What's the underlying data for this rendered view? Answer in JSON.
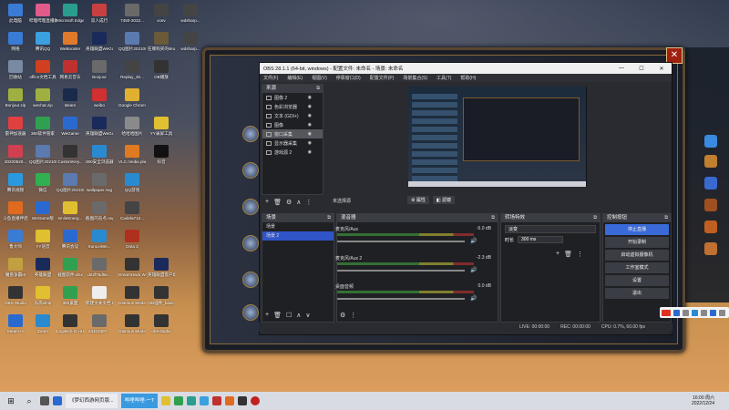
{
  "desktop": {
    "icons": [
      {
        "label": "此电脑",
        "color": "#3a7bd5"
      },
      {
        "label": "哔哩哔哩直播姬",
        "color": "#e05a8a"
      },
      {
        "label": "Microsoft Edge",
        "color": "#2a9d8f"
      },
      {
        "label": "双人成行",
        "color": "#c94040"
      },
      {
        "label": "7450-2022...",
        "color": "#6a6a6a"
      },
      {
        "label": "xcev",
        "color": "#444"
      },
      {
        "label": "wdsharp...",
        "color": "#444"
      },
      {
        "label": "网络",
        "color": "#3a7bd5"
      },
      {
        "label": "腾讯QQ",
        "color": "#3aa0e0"
      },
      {
        "label": "WeBooster",
        "color": "#e07a2a"
      },
      {
        "label": "英雄联盟WeGame版",
        "color": "#1a2a5a"
      },
      {
        "label": "QQ图片20210821...",
        "color": "#5a7ab0"
      },
      {
        "label": "在哪购买的sku...",
        "color": "#6a5a3a"
      },
      {
        "label": "wdsharp...",
        "color": "#444"
      },
      {
        "label": "回收站",
        "color": "#7a8aa0"
      },
      {
        "label": "office文档工具",
        "color": "#d04020"
      },
      {
        "label": "网易云音乐",
        "color": "#c03030"
      },
      {
        "label": "Bonjour",
        "color": "#6a6a6a"
      },
      {
        "label": "Replay_20...",
        "color": "#444"
      },
      {
        "label": "OB播放",
        "color": "#333"
      },
      {
        "label": "Bonjour.zip",
        "color": "#a0b040"
      },
      {
        "label": "wechat.zip",
        "color": "#a0b040"
      },
      {
        "label": "steam",
        "color": "#1a2a4a"
      },
      {
        "label": "weibo",
        "color": "#d03030"
      },
      {
        "label": "Google Chrome",
        "color": "#e0b030"
      },
      {
        "label": "雷神加速器",
        "color": "#e04040"
      },
      {
        "label": "360软件管家",
        "color": "#30a050"
      },
      {
        "label": "WeGame",
        "color": "#2a6ad0"
      },
      {
        "label": "英雄联盟WeGame版",
        "color": "#1a2a5a"
      },
      {
        "label": "哈哈哈图片",
        "color": "#8a8a8a"
      },
      {
        "label": "YY录屏工具",
        "color": "#e0c030"
      },
      {
        "label": "20220520...",
        "color": "#d04050"
      },
      {
        "label": "QQ图片202108...",
        "color": "#5a7ab0"
      },
      {
        "label": "CustomKey...",
        "color": "#333"
      },
      {
        "label": "360安全浏览器",
        "color": "#2a8ad0"
      },
      {
        "label": "VLC media player",
        "color": "#e07a20"
      },
      {
        "label": "抖音",
        "color": "#111"
      },
      {
        "label": "腾讯视频",
        "color": "#2a9ae0"
      },
      {
        "label": "微信",
        "color": "#30b050"
      },
      {
        "label": "QQ图片2021082...",
        "color": "#5a7ab0"
      },
      {
        "label": "wallpaper.rwg",
        "color": "#6a6a6a"
      },
      {
        "label": "QQ游戏",
        "color": "#2a8ad0"
      },
      {
        "label": "斗鱼直播伴侣",
        "color": "#e06a20"
      },
      {
        "label": "WeGame版",
        "color": "#2a6ad0"
      },
      {
        "label": "smileEnerg...",
        "color": "#e0c030"
      },
      {
        "label": "截图的盲点.rwg",
        "color": "#6a6a6a"
      },
      {
        "label": "Cadela712...",
        "color": "#444"
      },
      {
        "label": "鲁大师",
        "color": "#3a7bd5"
      },
      {
        "label": "YY语音",
        "color": "#e0c030"
      },
      {
        "label": "腾讯会议",
        "color": "#2a6ad0"
      },
      {
        "label": "XunLeiWe...",
        "color": "#2a8ad0"
      },
      {
        "label": "Dota 2",
        "color": "#b03020"
      },
      {
        "label": "魔兽争霸III",
        "color": "#c0a040"
      },
      {
        "label": "英雄联盟",
        "color": "#1a2a5a"
      },
      {
        "label": "截图软件.xlsx",
        "color": "#30a050"
      },
      {
        "label": "de2f75d5e...",
        "color": "#6a6a6a"
      },
      {
        "label": "DreamHack WC3 Opti...",
        "color": "#333"
      },
      {
        "label": "英雄联盟客户端",
        "color": "#1a2a5a"
      },
      {
        "label": "OBS Studio",
        "color": "#333"
      },
      {
        "label": "乐高whip",
        "color": "#e0c030"
      },
      {
        "label": "360桌面",
        "color": "#30a050"
      },
      {
        "label": "新建文本文档.txt",
        "color": "#eee"
      },
      {
        "label": "Glarious Model O...",
        "color": "#333"
      },
      {
        "label": "OB插件_basic",
        "color": "#333"
      },
      {
        "label": "Steam++",
        "color": "#2a6ad0"
      },
      {
        "label": "Zoom",
        "color": "#2a8ad0"
      },
      {
        "label": "Logitech G HUB",
        "color": "#333"
      },
      {
        "label": "2411030?...",
        "color": "#6a6a6a"
      },
      {
        "label": "Glarious Model O...",
        "color": "#333"
      },
      {
        "label": "obs-studio",
        "color": "#333"
      }
    ]
  },
  "obs": {
    "title": "OBS 28.1.1 (64-bit, windows) - 配置文件: 未命名 - 场景: 未命名",
    "win_min": "—",
    "win_max": "☐",
    "win_close": "✕",
    "menu": [
      "文件(F)",
      "编辑(E)",
      "视图(V)",
      "停靠窗口(D)",
      "配置文件(P)",
      "场景集合(S)",
      "工具(T)",
      "帮助(H)"
    ],
    "sources_title": "来源",
    "sources": [
      "图像 2",
      "色彩浏览器",
      "文本 (GDI+)",
      "图像",
      "窗口采集",
      "显示器采集",
      "游戏源 2"
    ],
    "selected_source_index": 4,
    "no_source_selected": "未选择源",
    "btn_properties": "属性",
    "btn_filters": "滤镜",
    "scenes_title": "场景",
    "scenes": [
      "场景",
      "场景 2"
    ],
    "selected_scene_index": 1,
    "mixer_title": "混音器",
    "mixer": [
      {
        "name": "麦克风/Aux",
        "db": "-5.0 dB"
      },
      {
        "name": "麦克风/Aux 2",
        "db": "-2.3 dB"
      },
      {
        "name": "桌面音频",
        "db": "0.0 dB"
      }
    ],
    "transition_title": "转场特效",
    "transition_value": "淡变",
    "duration_label": "时长",
    "duration_value": "300 ms",
    "controls_title": "控制按钮",
    "controls": [
      "停止直播",
      "开始录制",
      "启动虚拟摄像机",
      "工作室模式",
      "设置",
      "退出"
    ],
    "status_live": "LIVE: 00:00:00",
    "status_rec": "REC: 00:00:00",
    "status_cpu": "CPU: 0.7%, 60.00 fps"
  },
  "taskbar": {
    "start": "⊞",
    "search": "⌕",
    "app1": "《梦幻西游网页版...",
    "app2": "哔哩哔哩-一T",
    "time": "16:00 周六",
    "date": "2022/12/24"
  }
}
